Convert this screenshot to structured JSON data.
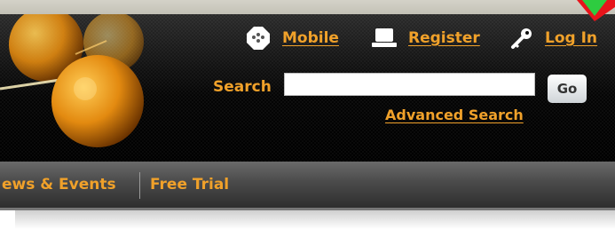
{
  "header": {
    "links": [
      {
        "label": "Mobile",
        "icon": "mobile-icon"
      },
      {
        "label": "Register",
        "icon": "register-icon"
      },
      {
        "label": "Log In",
        "icon": "key-icon"
      }
    ]
  },
  "search": {
    "label": "Search",
    "input_value": "",
    "button_label": "Go",
    "advanced_label": "Advanced Search"
  },
  "nav": {
    "items": [
      "ews & Events",
      "Free Trial"
    ]
  },
  "colors": {
    "accent": "#f0a12a",
    "header_bg": "#0e0e0e",
    "nav_bg": "#4a4a4a"
  }
}
